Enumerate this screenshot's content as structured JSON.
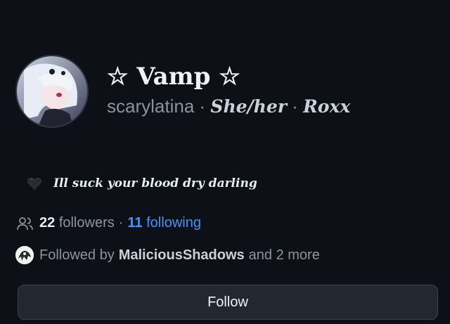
{
  "profile": {
    "display_name": "☆ Vamp ☆",
    "username": "scarylatina",
    "separator": " · ",
    "pronouns": "She/her",
    "extra": "Roxx",
    "bio_emoji": "black-heart-icon",
    "bio": "Ill suck your blood dry darling"
  },
  "stats": {
    "followers_count": "22",
    "followers_label": "followers",
    "dot": "·",
    "following_count": "11",
    "following_label": "following"
  },
  "followed_by": {
    "prefix": "Followed by",
    "name": "MaliciousShadows",
    "suffix": "and 2 more"
  },
  "actions": {
    "follow_label": "Follow"
  },
  "colors": {
    "background": "#0d1117",
    "link": "#4493f8",
    "muted": "#8b949e",
    "button_bg": "#212830"
  }
}
